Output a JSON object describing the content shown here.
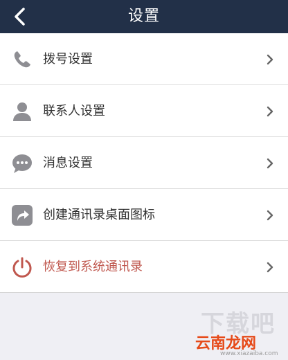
{
  "header": {
    "title": "设置",
    "back_icon": "chevron-left-icon"
  },
  "settings": [
    {
      "id": "dial",
      "label": "拨号设置",
      "icon": "phone-icon"
    },
    {
      "id": "contacts",
      "label": "联系人设置",
      "icon": "person-icon"
    },
    {
      "id": "messages",
      "label": "消息设置",
      "icon": "chat-bubble-icon"
    },
    {
      "id": "shortcut",
      "label": "创建通讯录桌面图标",
      "icon": "share-arrow-icon"
    },
    {
      "id": "restore",
      "label": "恢复到系统通讯录",
      "icon": "power-icon",
      "color": "#c0584f"
    }
  ],
  "watermark": {
    "brand": "云南龙网",
    "url": "www.xiazaiba.com"
  },
  "colors": {
    "header": "#223048",
    "icon_gray": "#8e8e93",
    "danger": "#c0584f"
  }
}
